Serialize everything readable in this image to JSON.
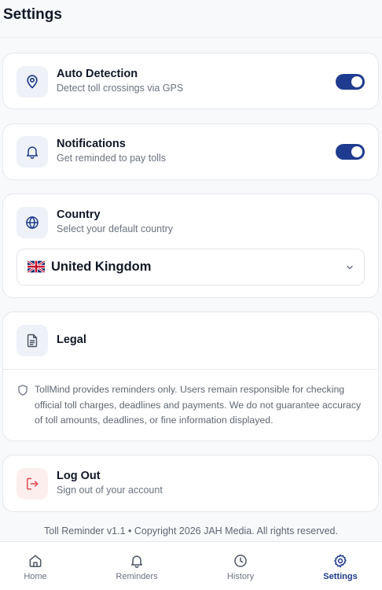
{
  "header": {
    "title": "Settings"
  },
  "auto_detection": {
    "icon": "location-pin-icon",
    "title": "Auto Detection",
    "subtitle": "Detect toll crossings via GPS",
    "enabled": true
  },
  "notifications": {
    "icon": "bell-icon",
    "title": "Notifications",
    "subtitle": "Get reminded to pay tolls",
    "enabled": true
  },
  "country": {
    "icon": "globe-icon",
    "title": "Country",
    "subtitle": "Select your default country",
    "selected_flag": "uk-flag-icon",
    "selected": "United Kingdom"
  },
  "legal": {
    "icon": "document-icon",
    "title": "Legal",
    "disclaimer_icon": "shield-icon",
    "disclaimer": "TollMind provides reminders only. Users remain responsible for checking official toll charges, deadlines and payments. We do not guarantee accuracy of toll amounts, deadlines, or fine information displayed."
  },
  "logout": {
    "icon": "logout-icon",
    "title": "Log Out",
    "subtitle": "Sign out of your account"
  },
  "footer": {
    "text": "Toll Reminder v1.1 • Copyright 2026 JAH Media. All rights reserved."
  },
  "nav": {
    "items": [
      {
        "label": "Home",
        "icon": "home-icon",
        "active": false
      },
      {
        "label": "Reminders",
        "icon": "bell-icon",
        "active": false
      },
      {
        "label": "History",
        "icon": "clock-icon",
        "active": false
      },
      {
        "label": "Settings",
        "icon": "gear-icon",
        "active": true
      }
    ]
  },
  "colors": {
    "accent": "#1e3a8a",
    "toggle_on": "#1f3b8f",
    "logout_red": "#e5484d",
    "icon_blue": "#1d3b8b"
  }
}
